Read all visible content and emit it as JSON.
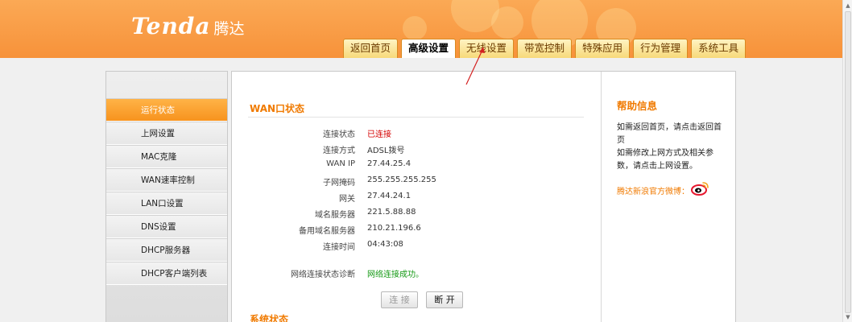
{
  "brand": {
    "name_en": "Tenda",
    "name_cn": "腾达"
  },
  "nav_tabs": [
    {
      "label": "返回首页",
      "active": false
    },
    {
      "label": "高级设置",
      "active": true
    },
    {
      "label": "无线设置",
      "active": false
    },
    {
      "label": "带宽控制",
      "active": false
    },
    {
      "label": "特殊应用",
      "active": false
    },
    {
      "label": "行为管理",
      "active": false
    },
    {
      "label": "系统工具",
      "active": false
    }
  ],
  "sidebar": {
    "items": [
      {
        "label": "运行状态",
        "active": true
      },
      {
        "label": "上网设置",
        "active": false
      },
      {
        "label": "MAC克隆",
        "active": false
      },
      {
        "label": "WAN速率控制",
        "active": false
      },
      {
        "label": "LAN口设置",
        "active": false
      },
      {
        "label": "DNS设置",
        "active": false
      },
      {
        "label": "DHCP服务器",
        "active": false
      },
      {
        "label": "DHCP客户端列表",
        "active": false
      }
    ]
  },
  "wan_status": {
    "title": "WAN口状态",
    "rows": [
      {
        "label": "连接状态",
        "value": "已连接",
        "style": "red"
      },
      {
        "label": "连接方式",
        "value": "ADSL拨号",
        "style": ""
      },
      {
        "label": "WAN IP",
        "value": "27.44.25.4",
        "style": ""
      },
      {
        "label": "子网掩码",
        "value": "255.255.255.255",
        "style": ""
      },
      {
        "label": "网关",
        "value": "27.44.24.1",
        "style": ""
      },
      {
        "label": "域名服务器",
        "value": "221.5.88.88",
        "style": ""
      },
      {
        "label": "备用域名服务器",
        "value": "210.21.196.6",
        "style": ""
      },
      {
        "label": "连接时间",
        "value": "04:43:08",
        "style": ""
      },
      {
        "label": "网络连接状态诊断",
        "value": "网络连接成功。",
        "style": "green"
      }
    ],
    "connect_label": "连 接",
    "disconnect_label": "断 开"
  },
  "system_status": {
    "title": "系统状态"
  },
  "help": {
    "title": "帮助信息",
    "text_1": "如需返回首页，请点击返回首页",
    "text_2": "如需修改上网方式及相关参数，请点击上网设置。",
    "weibo_label": "腾达新浪官方微博："
  },
  "colors": {
    "accent": "#f7931e",
    "header": "#f9a047",
    "error": "#d40000",
    "success": "#169a16"
  },
  "icons": {
    "weibo": "weibo-icon",
    "annotation": "red-arrow"
  }
}
